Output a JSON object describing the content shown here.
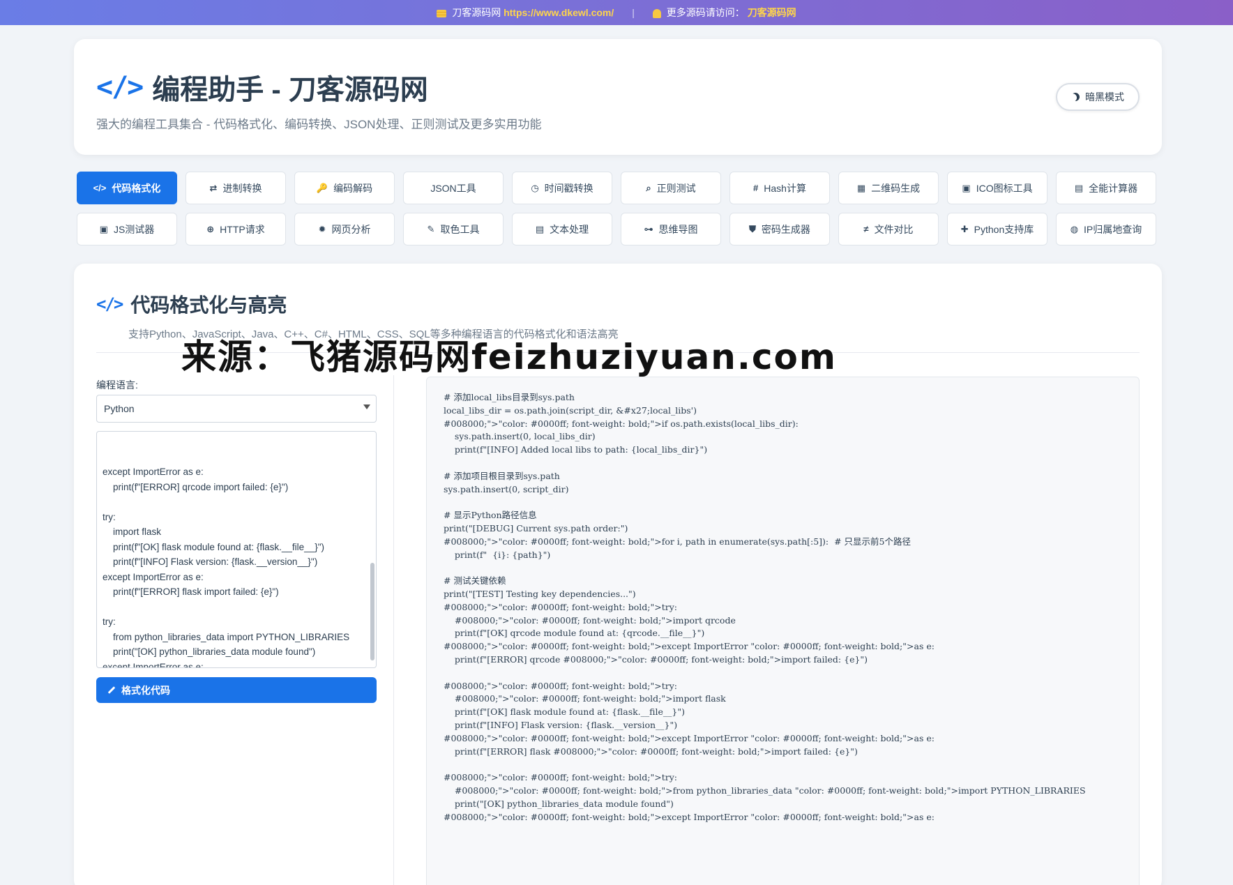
{
  "topbar": {
    "site_name": "刀客源码网",
    "site_url": "https://www.dkewl.com/",
    "more_label": "更多源码请访问：",
    "more_link": "刀客源码网"
  },
  "header": {
    "title": "编程助手 - 刀客源码网",
    "subtitle": "强大的编程工具集合 - 代码格式化、编码转换、JSON处理、正则测试及更多实用功能",
    "dark_mode_label": "暗黑模式"
  },
  "tabs": [
    {
      "label": "代码格式化",
      "icon": "</>"
    },
    {
      "label": "进制转换",
      "icon": "⇄"
    },
    {
      "label": "编码解码",
      "icon": "🔑"
    },
    {
      "label": "JSON工具",
      "icon": ""
    },
    {
      "label": "时间戳转换",
      "icon": "◷"
    },
    {
      "label": "正则测试",
      "icon": "⌕"
    },
    {
      "label": "Hash计算",
      "icon": "#"
    },
    {
      "label": "二维码生成",
      "icon": "▦"
    },
    {
      "label": "ICO图标工具",
      "icon": "▣"
    },
    {
      "label": "全能计算器",
      "icon": "▤"
    },
    {
      "label": "JS测试器",
      "icon": "▣"
    },
    {
      "label": "HTTP请求",
      "icon": "⊕"
    },
    {
      "label": "网页分析",
      "icon": "✹"
    },
    {
      "label": "取色工具",
      "icon": "✎"
    },
    {
      "label": "文本处理",
      "icon": "▤"
    },
    {
      "label": "思维导图",
      "icon": "⊶"
    },
    {
      "label": "密码生成器",
      "icon": "⛊"
    },
    {
      "label": "文件对比",
      "icon": "≠"
    },
    {
      "label": "Python支持库",
      "icon": "✚"
    },
    {
      "label": "IP归属地查询",
      "icon": "◍"
    }
  ],
  "section": {
    "title": "代码格式化与高亮",
    "subtitle": "支持Python、JavaScript、Java、C++、C#、HTML、CSS、SQL等多种编程语言的代码格式化和语法高亮"
  },
  "form": {
    "language_label": "编程语言:",
    "language_value": "Python",
    "code_input": "except ImportError as e:\n    print(f\"[ERROR] qrcode import failed: {e}\")\n\ntry:\n    import flask\n    print(f\"[OK] flask module found at: {flask.__file__}\")\n    print(f\"[INFO] Flask version: {flask.__version__}\")\nexcept ImportError as e:\n    print(f\"[ERROR] flask import failed: {e}\")\n\ntry:\n    from python_libraries_data import PYTHON_LIBRARIES\n    print(\"[OK] python_libraries_data module found\")\nexcept ImportError as e:\n    print(f\"[ERROR] python_libraries_data import failed: {e}\")",
    "format_button": "格式化代码"
  },
  "output": {
    "code": "# 添加local_libs目录到sys.path\nlocal_libs_dir = os.path.join(script_dir, &#x27;local_libs')\n#008000;\">\"color: #0000ff; font-weight: bold;\">if os.path.exists(local_libs_dir):\n    sys.path.insert(0, local_libs_dir)\n    print(f\"[INFO] Added local libs to path: {local_libs_dir}\")\n\n# 添加项目根目录到sys.path\nsys.path.insert(0, script_dir)\n\n# 显示Python路径信息\nprint(\"[DEBUG] Current sys.path order:\")\n#008000;\">\"color: #0000ff; font-weight: bold;\">for i, path in enumerate(sys.path[:5]):  # 只显示前5个路径\n    print(f\"  {i}: {path}\")\n\n# 测试关键依赖\nprint(\"[TEST] Testing key dependencies...\")\n#008000;\">\"color: #0000ff; font-weight: bold;\">try:\n    #008000;\">\"color: #0000ff; font-weight: bold;\">import qrcode\n    print(f\"[OK] qrcode module found at: {qrcode.__file__}\")\n#008000;\">\"color: #0000ff; font-weight: bold;\">except ImportError \"color: #0000ff; font-weight: bold;\">as e:\n    print(f\"[ERROR] qrcode #008000;\">\"color: #0000ff; font-weight: bold;\">import failed: {e}\")\n\n#008000;\">\"color: #0000ff; font-weight: bold;\">try:\n    #008000;\">\"color: #0000ff; font-weight: bold;\">import flask\n    print(f\"[OK] flask module found at: {flask.__file__}\")\n    print(f\"[INFO] Flask version: {flask.__version__}\")\n#008000;\">\"color: #0000ff; font-weight: bold;\">except ImportError \"color: #0000ff; font-weight: bold;\">as e:\n    print(f\"[ERROR] flask #008000;\">\"color: #0000ff; font-weight: bold;\">import failed: {e}\")\n\n#008000;\">\"color: #0000ff; font-weight: bold;\">try:\n    #008000;\">\"color: #0000ff; font-weight: bold;\">from python_libraries_data \"color: #0000ff; font-weight: bold;\">import PYTHON_LIBRARIES\n    print(\"[OK] python_libraries_data module found\")\n#008000;\">\"color: #0000ff; font-weight: bold;\">except ImportError \"color: #0000ff; font-weight: bold;\">as e:"
  },
  "watermark": "来源：飞猪源码网feizhuziyuan.com",
  "colors": {
    "accent": "#1a73e8",
    "link_yellow": "#ffd54a"
  }
}
